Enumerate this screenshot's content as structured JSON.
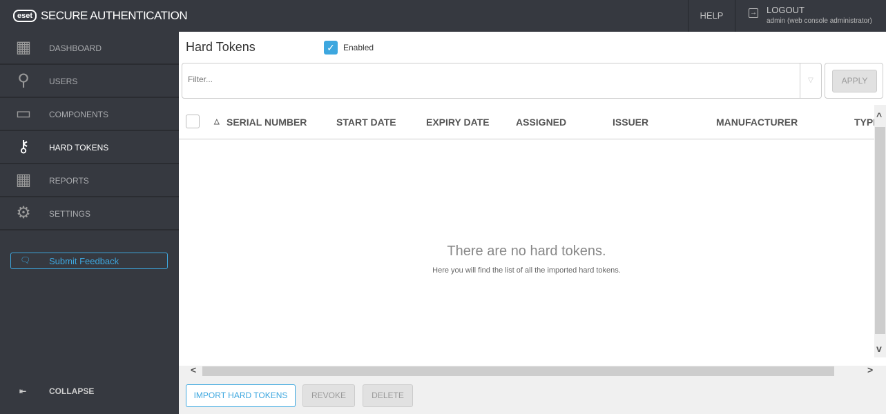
{
  "header": {
    "logo": "eset",
    "title": "SECURE AUTHENTICATION",
    "help": "HELP",
    "logout": "LOGOUT",
    "user": "admin (web console administrator)"
  },
  "sidebar": {
    "items": [
      {
        "label": "DASHBOARD",
        "icon": "dashboard-icon"
      },
      {
        "label": "USERS",
        "icon": "user-icon"
      },
      {
        "label": "COMPONENTS",
        "icon": "monitor-icon"
      },
      {
        "label": "HARD TOKENS",
        "icon": "key-icon",
        "active": true
      },
      {
        "label": "REPORTS",
        "icon": "grid-icon"
      },
      {
        "label": "SETTINGS",
        "icon": "gear-icon"
      }
    ],
    "feedback": "Submit Feedback",
    "collapse": "COLLAPSE"
  },
  "main": {
    "title": "Hard Tokens",
    "enabled_label": "Enabled",
    "enabled": true,
    "filter_placeholder": "Filter...",
    "apply": "APPLY",
    "columns": [
      "SERIAL NUMBER",
      "START DATE",
      "EXPIRY DATE",
      "ASSIGNED",
      "ISSUER",
      "MANUFACTURER",
      "TYPE"
    ],
    "empty_title": "There are no hard tokens.",
    "empty_sub": "Here you will find the list of all the imported hard tokens.",
    "buttons": {
      "import": "IMPORT HARD TOKENS",
      "revoke": "REVOKE",
      "delete": "DELETE"
    }
  },
  "colors": {
    "accent": "#3da7df",
    "header_bg": "#363940"
  }
}
